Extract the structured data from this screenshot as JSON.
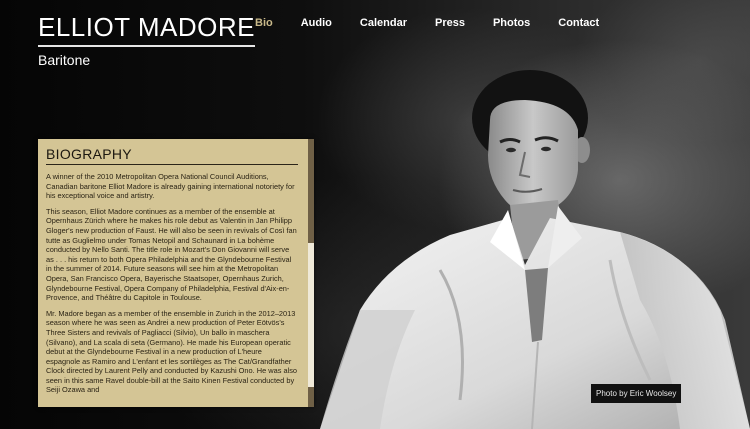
{
  "header": {
    "title": "ELLIOT MADORE",
    "subtitle": "Baritone"
  },
  "nav": {
    "items": [
      {
        "label": "Bio",
        "active": true
      },
      {
        "label": "Audio",
        "active": false
      },
      {
        "label": "Calendar",
        "active": false
      },
      {
        "label": "Press",
        "active": false
      },
      {
        "label": "Photos",
        "active": false
      },
      {
        "label": "Contact",
        "active": false
      }
    ],
    "active_color": "#c9b98a"
  },
  "bio": {
    "heading": "BIOGRAPHY",
    "paragraphs": [
      "A winner of the 2010 Metropolitan Opera National Council Auditions, Canadian baritone Elliot Madore is already gaining international notoriety for his exceptional voice and artistry.",
      "This season, Elliot Madore continues as a member of the ensemble at Opernhaus Zürich where he makes his role debut as Valentin in Jan Philipp Gloger's new production of Faust. He will also be seen in revivals of Così fan tutte as Guglielmo under Tomas Netopil and Schaunard in La bohème conducted by Nello Santi. The title role in Mozart's Don Giovanni will serve as . . . his return to both Opera Philadelphia and the Glyndebourne Festival in the summer of 2014. Future seasons will see him at the Metropolitan Opera, San Francisco Opera, Bayerische Staatsoper, Opernhaus Zurich, Glyndebourne Festival, Opera Company of Philadelphia, Festival d'Aix-en-Provence, and Théâtre du Capitole in Toulouse.",
      "Mr. Madore began as a member of the ensemble in Zurich in the 2012–2013 season where he was seen as Andrei a new production of Peter Eötvös's Three Sisters and revivals of Pagliacci (Silvio), Un ballo in maschera (Silvano), and La scala di seta (Germano). He made his European operatic debut at the Glyndebourne Festival in a new production of L'heure espagnole as Ramiro and L'enfant et les sortilèges as The Cat/Grandfather Clock directed by Laurent Pelly and conducted by Kazushi Ono. He was also seen in this same Ravel double-bill at the Saito Kinen Festival conducted by Seiji Ozawa and"
    ]
  },
  "photo": {
    "credit": "Photo by Eric Woolsey"
  }
}
